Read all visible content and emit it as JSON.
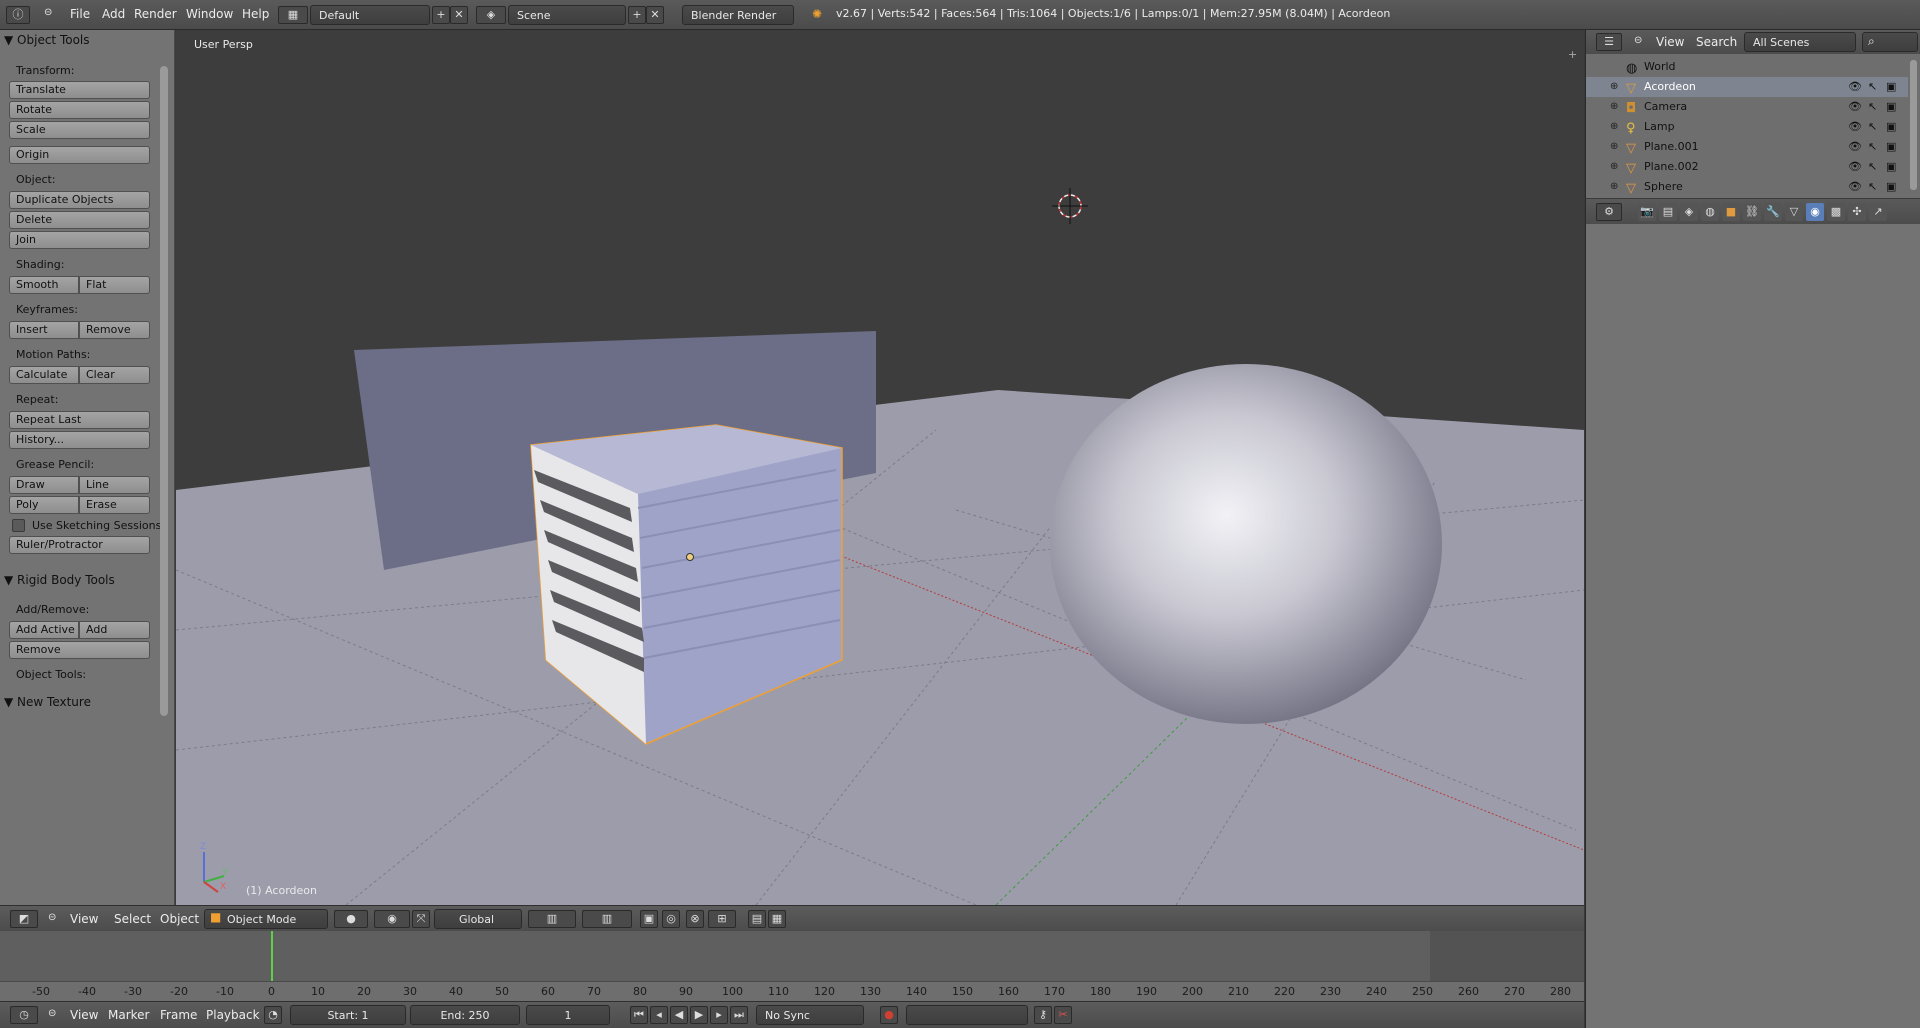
{
  "topbar": {
    "menu": [
      "File",
      "Add",
      "Render",
      "Window",
      "Help"
    ],
    "screen_layout": "Default",
    "scene": "Scene",
    "render_engine": "Blender Render",
    "stats": "v2.67 | Verts:542 | Faces:564 | Tris:1064 | Objects:1/6 | Lamps:0/1 | Mem:27.95M (8.04M) | Acordeon"
  },
  "toolshelf": {
    "object_tools_header": "Object Tools",
    "transform_label": "Transform:",
    "translate": "Translate",
    "rotate": "Rotate",
    "scale": "Scale",
    "origin": "Origin",
    "object_label": "Object:",
    "duplicate": "Duplicate Objects",
    "delete": "Delete",
    "join": "Join",
    "shading_label": "Shading:",
    "smooth": "Smooth",
    "flat": "Flat",
    "keyframes_label": "Keyframes:",
    "insert": "Insert",
    "remove_kf": "Remove",
    "motion_paths_label": "Motion Paths:",
    "calculate": "Calculate",
    "clear": "Clear",
    "repeat_label": "Repeat:",
    "repeat_last": "Repeat Last",
    "history": "History...",
    "grease_pencil_label": "Grease Pencil:",
    "draw": "Draw",
    "line": "Line",
    "poly": "Poly",
    "erase": "Erase",
    "use_sketching": "Use Sketching Sessions",
    "ruler": "Ruler/Protractor",
    "rigid_body_header": "Rigid Body Tools",
    "add_remove_label": "Add/Remove:",
    "add_active": "Add Active",
    "add_passive": "Add Passive",
    "remove_rb": "Remove",
    "object_tools_label": "Object Tools:",
    "new_texture_header": "New Texture"
  },
  "viewport": {
    "view_name": "User Persp",
    "active_object": "(1) Acordeon",
    "axis_z": "Z",
    "axis_y": "Y",
    "axis_x": "X"
  },
  "viewport_header": {
    "view": "View",
    "select": "Select",
    "object": "Object",
    "mode": "Object Mode",
    "orientation": "Global"
  },
  "timeline": {
    "ticks": [
      "-50",
      "-40",
      "-30",
      "-20",
      "-10",
      "0",
      "10",
      "20",
      "30",
      "40",
      "50",
      "60",
      "70",
      "80",
      "90",
      "100",
      "110",
      "120",
      "130",
      "140",
      "150",
      "160",
      "170",
      "180",
      "190",
      "200",
      "210",
      "220",
      "230",
      "240",
      "250",
      "260",
      "270",
      "280"
    ],
    "current_frame": 0,
    "view": "View",
    "marker": "Marker",
    "frame": "Frame",
    "playback": "Playback",
    "start": "Start: 1",
    "end": "End: 250",
    "frame_value": "1",
    "sync": "No Sync"
  },
  "outliner": {
    "view": "View",
    "search": "Search",
    "filter": "All Scenes",
    "items": [
      {
        "name": "World",
        "icon": "world-icon"
      },
      {
        "name": "Acordeon",
        "icon": "mesh-icon",
        "active": true
      },
      {
        "name": "Camera",
        "icon": "camera-icon"
      },
      {
        "name": "Lamp",
        "icon": "lamp-icon"
      },
      {
        "name": "Plane.001",
        "icon": "mesh-icon"
      },
      {
        "name": "Plane.002",
        "icon": "mesh-icon"
      },
      {
        "name": "Sphere",
        "icon": "mesh-icon"
      }
    ]
  },
  "colors": {
    "selection_outline": "#f0a030",
    "viewport_bg": "#3d3d3d",
    "floor": "#9d9cab"
  }
}
